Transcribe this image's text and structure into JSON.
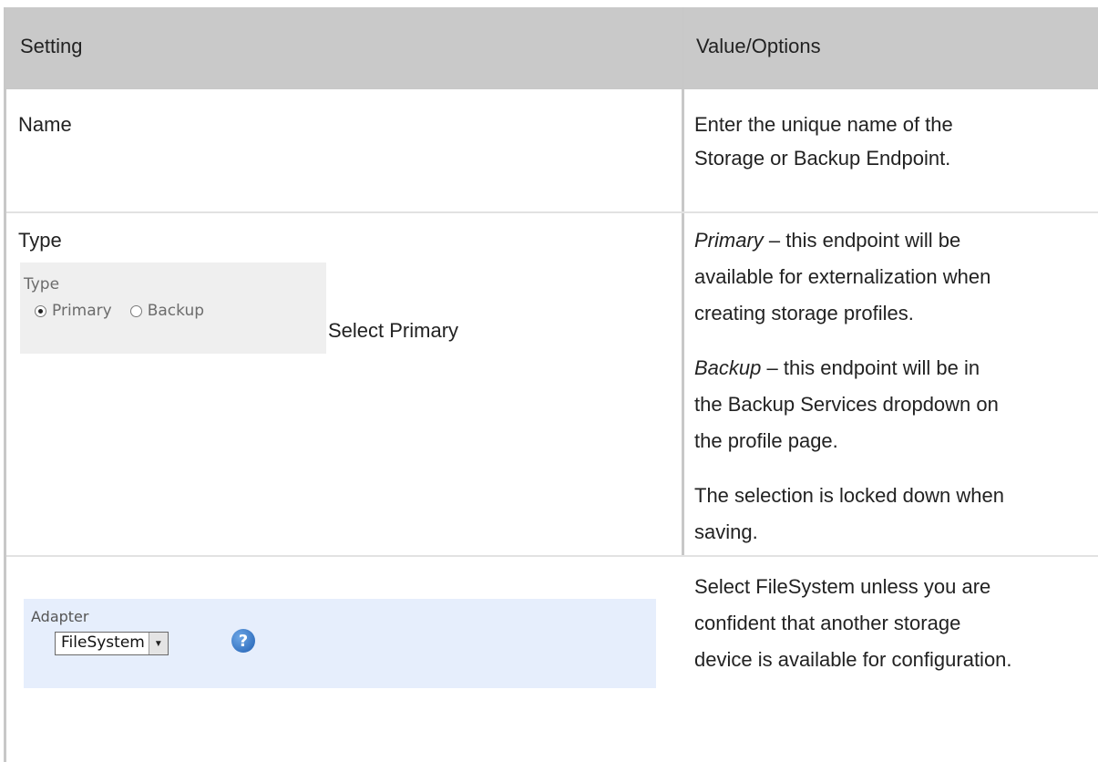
{
  "header": {
    "setting": "Setting",
    "value": "Value/Options"
  },
  "rows": {
    "name": {
      "setting": "Name",
      "value_lines": [
        "Enter the unique name of the",
        "Storage or Backup Endpoint."
      ]
    },
    "type": {
      "setting": "Type",
      "widget_label": "Type",
      "options": [
        "Primary",
        "Backup"
      ],
      "selected": "Primary",
      "note": "Select Primary",
      "primary_term": "Primary",
      "primary_lines": [
        "– this endpoint will be",
        "available for externalization when",
        "creating storage profiles."
      ],
      "backup_term": "Backup",
      "backup_lines": [
        "– this endpoint will be in",
        "the Backup Services dropdown on",
        "the profile page."
      ],
      "lock_lines": [
        "The selection is locked down when",
        "saving."
      ]
    },
    "adapter": {
      "widget_label": "Adapter",
      "selected_value": "FileSystem",
      "help_icon_text": "?",
      "value_lines": [
        "Select FileSystem unless you are",
        "confident that another storage",
        "device is available for configuration."
      ]
    }
  }
}
